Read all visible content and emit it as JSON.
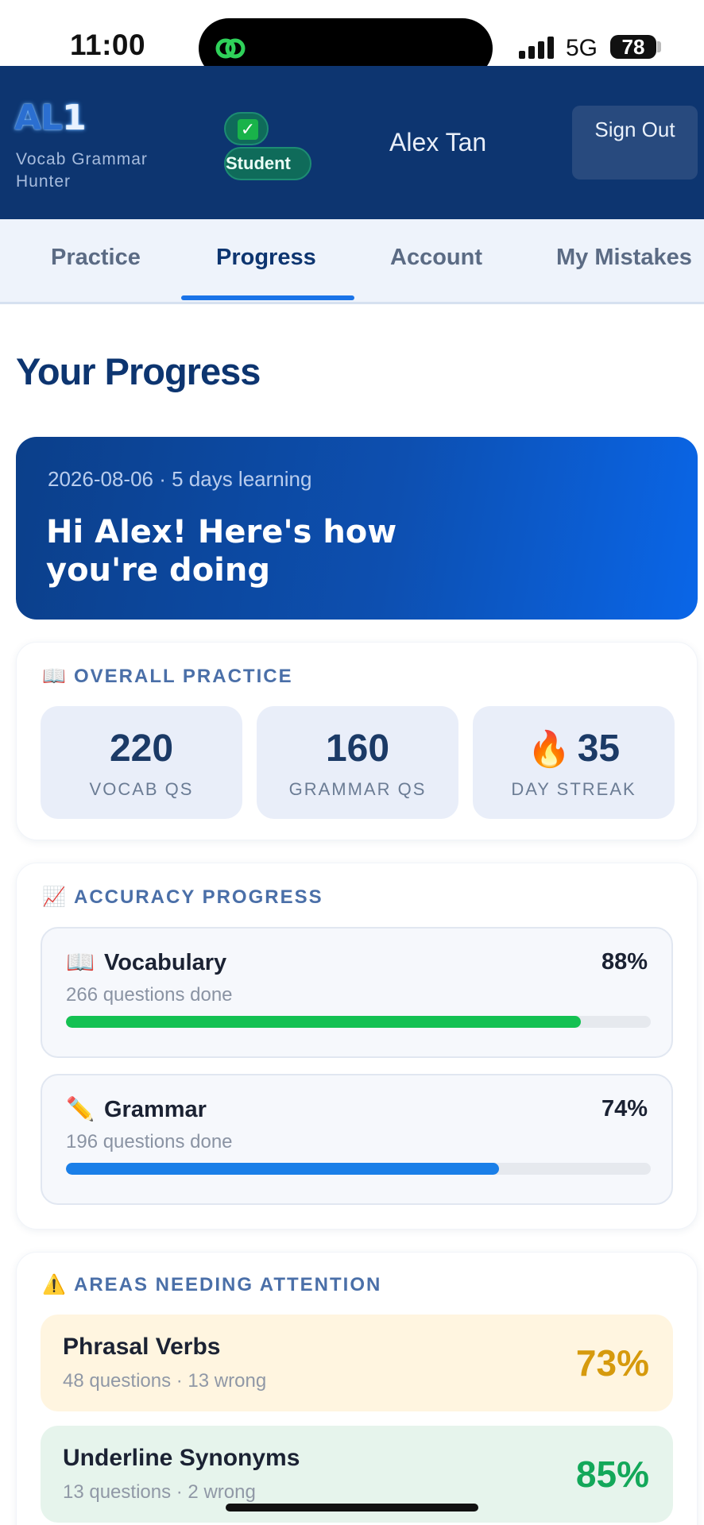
{
  "status_bar": {
    "time": "11:00",
    "network": "5G",
    "battery": "78"
  },
  "header": {
    "logo_a": "AL",
    "logo_b": "1",
    "tagline": "Vocab Grammar Hunter",
    "verified_mark": "✓",
    "role": "Student",
    "user_name": "Alex Tan",
    "sign_out_label": "Sign Out"
  },
  "tabs": [
    {
      "label": "Practice",
      "active": false
    },
    {
      "label": "Progress",
      "active": true
    },
    {
      "label": "Account",
      "active": false
    },
    {
      "label": "My Mistakes",
      "active": false
    }
  ],
  "page_title": "Your Progress",
  "hero": {
    "date_line": "2026-08-06 · 5 days learning",
    "greeting": "Hi Alex! Here's how you're doing"
  },
  "overall": {
    "icon": "📖",
    "title": "OVERALL PRACTICE",
    "stats": [
      {
        "value": "220",
        "label": "VOCAB QS",
        "icon": ""
      },
      {
        "value": "160",
        "label": "GRAMMAR QS",
        "icon": ""
      },
      {
        "value": "35",
        "label": "DAY STREAK",
        "icon": "🔥"
      }
    ]
  },
  "accuracy": {
    "icon": "📈",
    "title": "ACCURACY PROGRESS",
    "items": [
      {
        "icon": "📖",
        "name": "Vocabulary",
        "percent_label": "88%",
        "percent": 88,
        "sub": "266 questions done",
        "color": "#14c152"
      },
      {
        "icon": "✏️",
        "name": "Grammar",
        "percent_label": "74%",
        "percent": 74,
        "sub": "196 questions done",
        "color": "#1a7fe8"
      }
    ]
  },
  "attention": {
    "icon": "⚠️",
    "title": "AREAS NEEDING ATTENTION",
    "items": [
      {
        "name": "Phrasal Verbs",
        "sub": "48 questions · 13 wrong",
        "percent_label": "73%",
        "bg": "#fff5e0",
        "color": "#d69a0d"
      },
      {
        "name": "Underline Synonyms",
        "sub": "13 questions · 2 wrong",
        "percent_label": "85%",
        "bg": "#e6f4ec",
        "color": "#13a85a"
      }
    ]
  }
}
